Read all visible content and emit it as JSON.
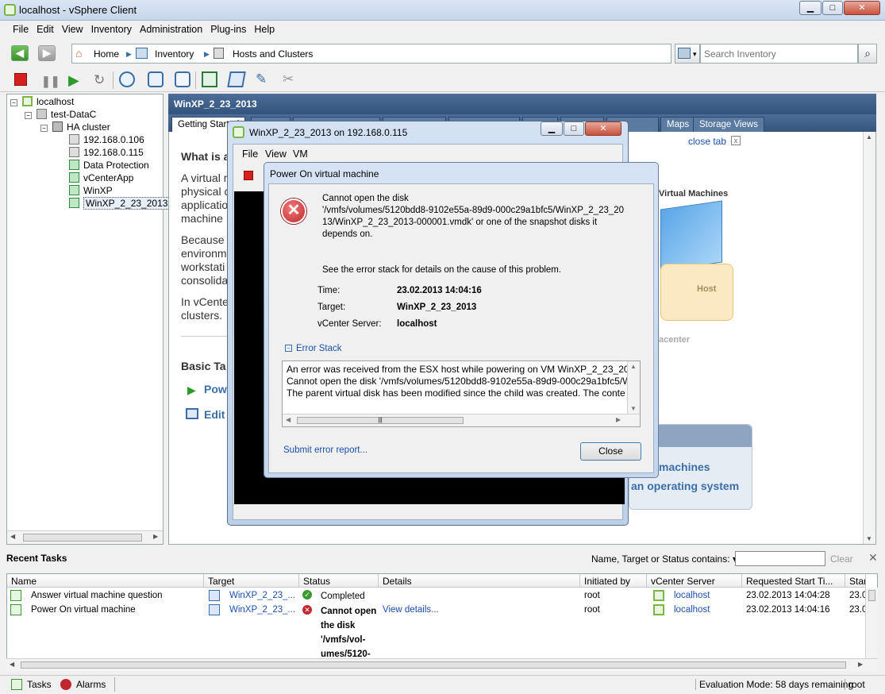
{
  "window": {
    "title": "localhost - vSphere Client",
    "minimize": "▁",
    "maximize": "□",
    "close": "✕"
  },
  "menu": [
    "File",
    "Edit",
    "View",
    "Inventory",
    "Administration",
    "Plug-ins",
    "Help"
  ],
  "breadcrumb": {
    "home": "Home",
    "inventory": "Inventory",
    "hosts": "Hosts and Clusters"
  },
  "search": {
    "placeholder": "Search Inventory"
  },
  "tree": {
    "root": "localhost",
    "datacenter": "test-DataC",
    "cluster": "HA cluster",
    "items": [
      "192.168.0.106",
      "192.168.0.115",
      "Data Protection",
      "vCenterApp",
      "WinXP",
      "WinXP_2_23_2013"
    ]
  },
  "main": {
    "header": "WinXP_2_23_2013",
    "tabs": [
      "Getting Started",
      "Maps",
      "Storage Views"
    ],
    "close_tab": "close tab",
    "heading": "What is a",
    "para1": [
      "A virtual m",
      "physical c",
      "applicatio",
      "machine"
    ],
    "para2": [
      "Because",
      "environm",
      "workstati",
      "consolida"
    ],
    "para3": [
      "In vCente",
      "clusters."
    ],
    "basic_tasks": "Basic Ta",
    "task_power": "Powe",
    "task_edit": "Edit",
    "diagram_vms": "Virtual Machines",
    "diagram_host": "Host",
    "diagram_dc": "acenter",
    "promo_line1": "machines",
    "promo_line2": "an operating system"
  },
  "console": {
    "title": "WinXP_2_23_2013 on 192.168.0.115",
    "menu": [
      "File",
      "View",
      "VM"
    ]
  },
  "dialog": {
    "title": "Power On virtual machine",
    "message": [
      "Cannot open the disk",
      "'/vmfs/volumes/5120bdd8-9102e55a-89d9-000c29a1bfc5/WinXP_2_23_20",
      "13/WinXP_2_23_2013-000001.vmdk' or one of the snapshot disks it",
      "depends on."
    ],
    "see_stack": "See the error stack for details on the cause of this problem.",
    "time_label": "Time:",
    "time_value": "23.02.2013 14:04:16",
    "target_label": "Target:",
    "target_value": "WinXP_2_23_2013",
    "server_label": "vCenter Server:",
    "server_value": "localhost",
    "stack_label": "Error Stack",
    "stack": [
      "An error was received from the ESX host while powering on VM WinXP_2_23_2013",
      "Cannot open the disk '/vmfs/volumes/5120bdd8-9102e55a-89d9-000c29a1bfc5/W",
      "The parent virtual disk has been modified since the child was created. The conte"
    ],
    "submit": "Submit error report...",
    "close": "Close"
  },
  "tasks": {
    "title": "Recent Tasks",
    "filter_label": "Name, Target or Status contains: ▾",
    "clear": "Clear",
    "columns": [
      "Name",
      "Target",
      "Status",
      "Details",
      "Initiated by",
      "vCenter Server",
      "Requested Start Ti...",
      "Star"
    ],
    "rows": [
      {
        "name": "Answer virtual machine question",
        "target": "WinXP_2_23_...",
        "status": "Completed",
        "details": "",
        "by": "root",
        "server": "localhost",
        "start": "23.02.2013 14:04:28",
        "st": "23.0"
      },
      {
        "name": "Power On virtual machine",
        "target": "WinXP_2_23_...",
        "status": "Cannot open the disk '/vmfs/vol-umes/5120-",
        "details": "View details...",
        "by": "root",
        "server": "localhost",
        "start": "23.02.2013 14:04:16",
        "st": "23.0"
      }
    ],
    "status_lines": [
      "Cannot open",
      "the disk",
      "'/vmfs/vol-",
      "umes/5120-"
    ]
  },
  "statusbar": {
    "tasks": "Tasks",
    "alarms": "Alarms",
    "eval": "Evaluation Mode: 58 days remaining",
    "user": "root"
  },
  "colors": {
    "accent": "#33547c",
    "link": "#1a4fb0",
    "error": "#c0282d",
    "ok": "#3a9a2f"
  }
}
